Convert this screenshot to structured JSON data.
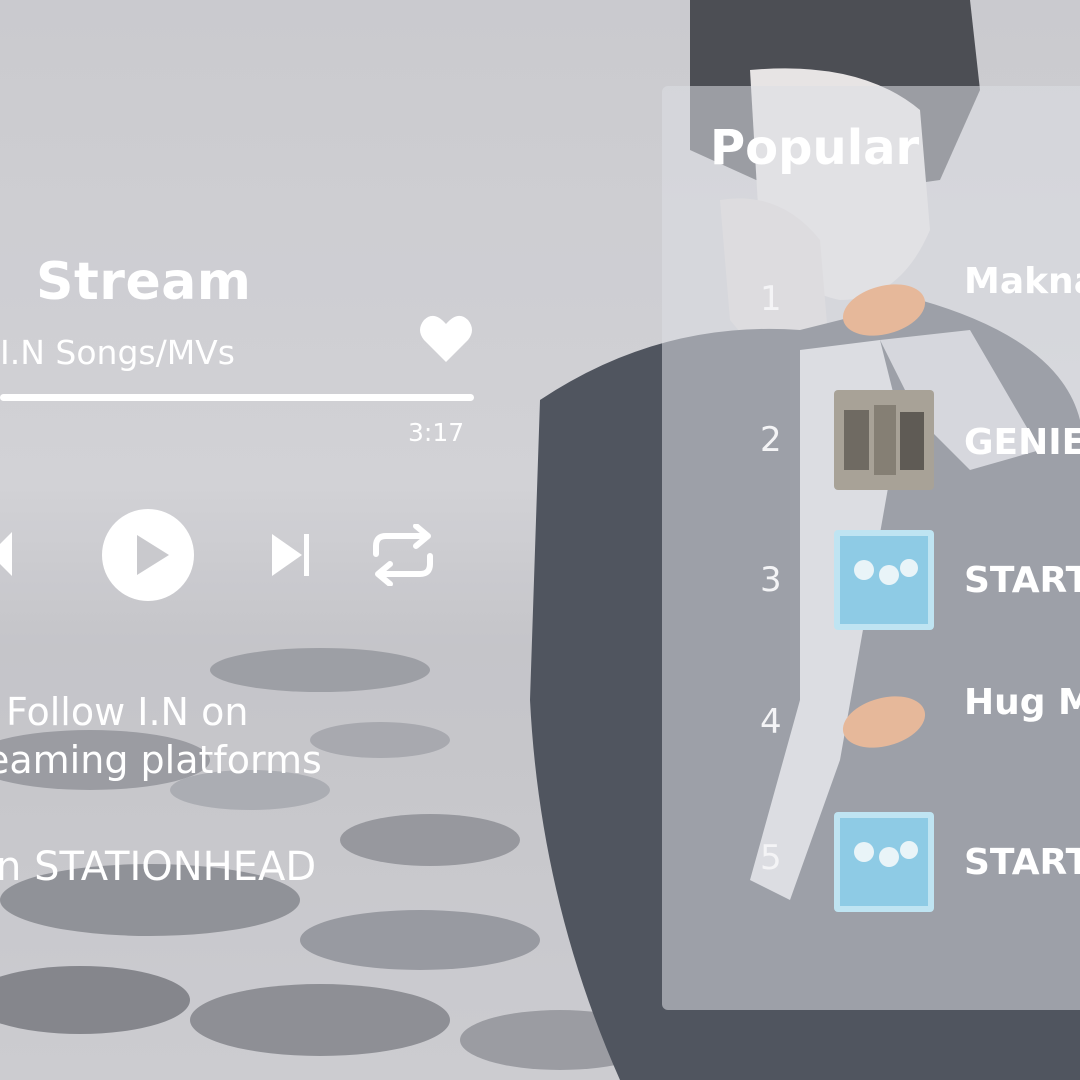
{
  "player": {
    "title": "Stream",
    "subtitle": "I.N Songs/MVs",
    "time": "3:17",
    "progress": 1.0,
    "liked": true
  },
  "info": {
    "follow_line1": "Follow I.N on",
    "follow_line2": "eaming platforms",
    "station_line": "n STATIONHEAD"
  },
  "popular": {
    "title": "Popular",
    "tracks": [
      {
        "num": "1",
        "name": "Makna"
      },
      {
        "num": "2",
        "name": "GENIE"
      },
      {
        "num": "3",
        "name": "START"
      },
      {
        "num": "4",
        "name": "Hug M"
      },
      {
        "num": "5",
        "name": "START"
      }
    ]
  },
  "icons": {
    "heart": "heart-icon",
    "prev": "skip-previous-icon",
    "play": "play-icon",
    "next": "skip-next-icon",
    "repeat": "repeat-icon"
  },
  "colors": {
    "foreground": "#ffffff",
    "background": "#c9c9cd",
    "jacket": "#2f3540"
  }
}
